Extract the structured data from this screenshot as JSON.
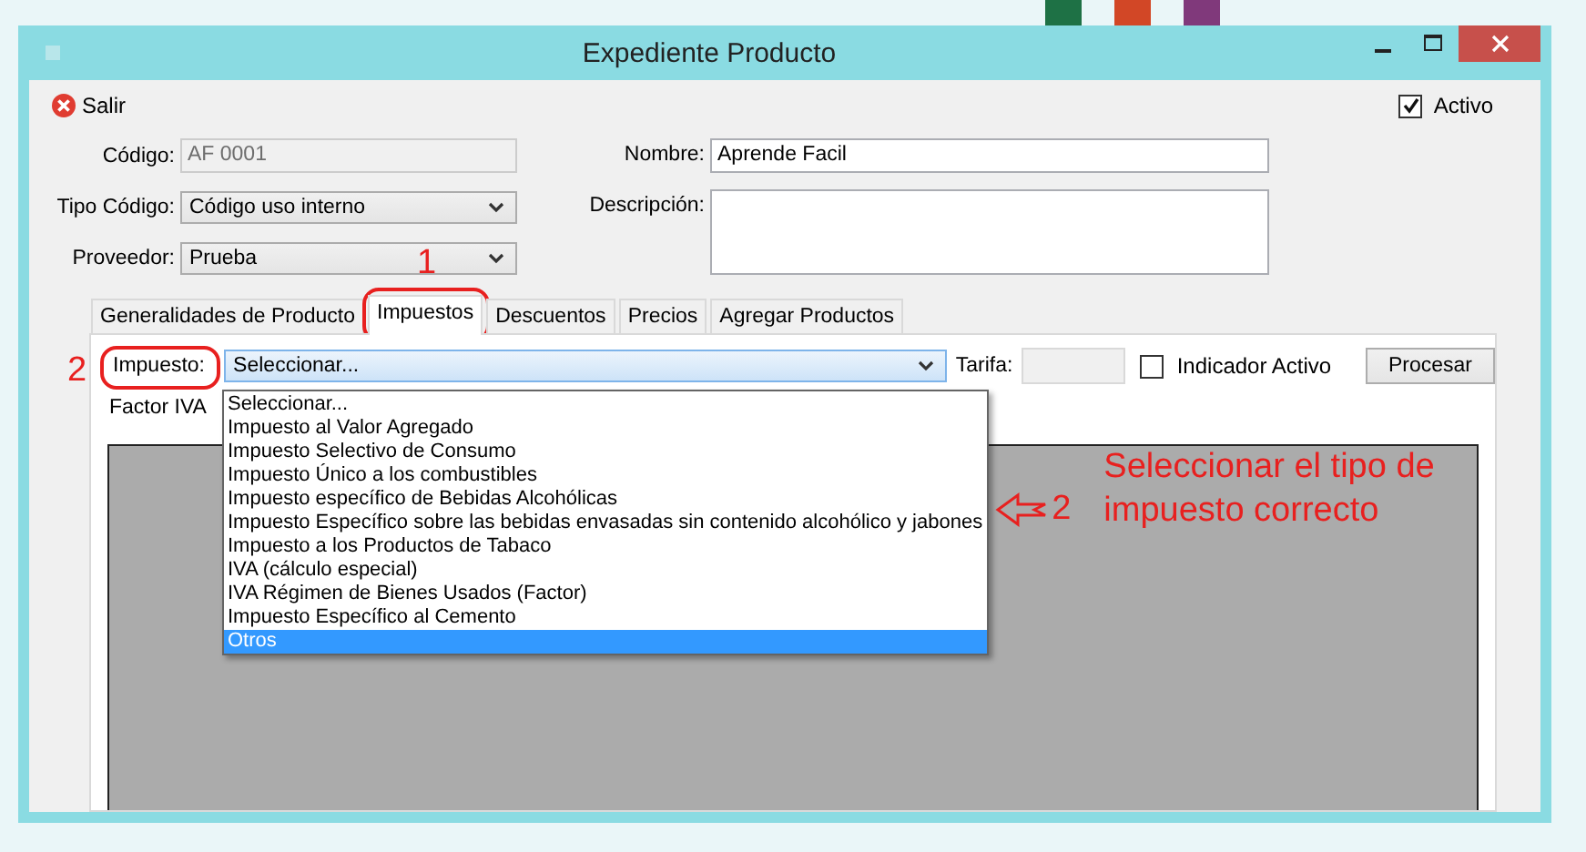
{
  "window": {
    "title": "Expediente Producto"
  },
  "toolbar": {
    "exit_label": "Salir",
    "active": {
      "label": "Activo",
      "checked": true
    }
  },
  "fields": [
    {
      "kind": "text",
      "label": "Código:",
      "value": "AF 0001",
      "disabled": true
    },
    {
      "kind": "combo",
      "label": "Tipo Código:",
      "value": "Código uso interno"
    },
    {
      "kind": "combo",
      "label": "Proveedor:",
      "value": "Prueba"
    }
  ],
  "right_fields": [
    {
      "kind": "text",
      "label": "Nombre:",
      "value": "Aprende Facil"
    },
    {
      "kind": "area",
      "label": "Descripción:"
    }
  ],
  "tabs": [
    {
      "label": "Generalidades de Producto",
      "selected": false
    },
    {
      "label": "Impuestos",
      "selected": true,
      "step": "1"
    },
    {
      "label": "Descuentos",
      "selected": false
    },
    {
      "label": "Precios",
      "selected": false
    },
    {
      "label": "Agregar Productos",
      "selected": false
    }
  ],
  "tax_panel": {
    "tax_label": "Impuesto:",
    "tax_step": "2",
    "tax_value": "Seleccionar...",
    "rate_label": "Tarifa:",
    "indicator": {
      "label": "Indicador Activo",
      "checked": false
    },
    "process_button": "Procesar",
    "factor_label": "Factor IVA",
    "options": [
      {
        "label": "Seleccionar...",
        "selected": false
      },
      {
        "label": "Impuesto al Valor Agregado",
        "selected": false
      },
      {
        "label": "Impuesto Selectivo de Consumo",
        "selected": false
      },
      {
        "label": "Impuesto Único a los combustibles",
        "selected": false
      },
      {
        "label": "Impuesto específico de Bebidas Alcohólicas",
        "selected": false
      },
      {
        "label": "Impuesto Específico sobre las bebidas envasadas sin contenido alcohólico y jabones",
        "selected": false
      },
      {
        "label": "Impuesto a los Productos de Tabaco",
        "selected": false
      },
      {
        "label": "IVA (cálculo especial)",
        "selected": false
      },
      {
        "label": "IVA Régimen de Bienes Usados (Factor)",
        "selected": false
      },
      {
        "label": "Impuesto Específico al Cemento",
        "selected": false
      },
      {
        "label": "Otros",
        "selected": true
      }
    ],
    "callout": {
      "step": "2",
      "text": "Seleccionar el tipo de impuesto correcto"
    }
  }
}
